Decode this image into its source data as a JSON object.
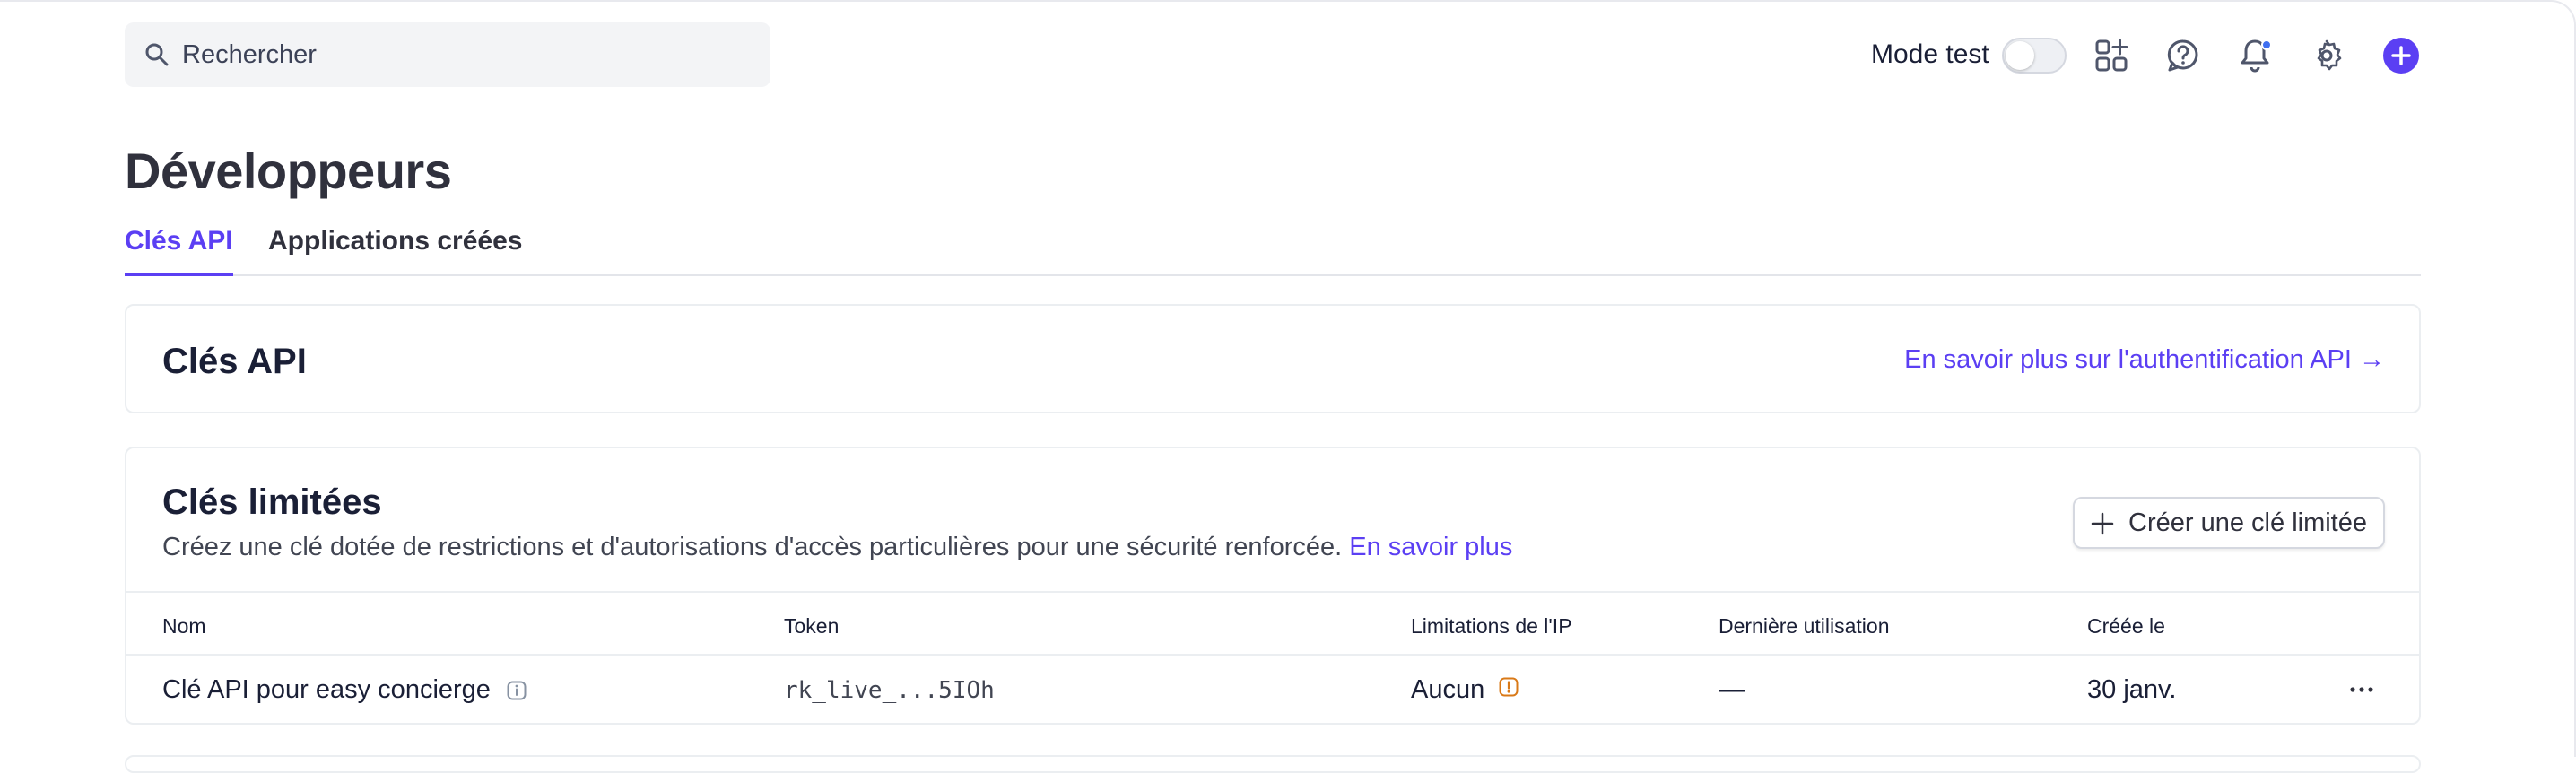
{
  "search": {
    "placeholder": "Rechercher"
  },
  "topbar": {
    "mode_label": "Mode test",
    "icons": [
      "search-icon",
      "apps-add-icon",
      "help-icon",
      "bell-icon",
      "gear-icon",
      "plus-icon"
    ],
    "accent": "#5b3ff3"
  },
  "page": {
    "title": "Développeurs"
  },
  "tabs": [
    {
      "label": "Clés API",
      "active": true
    },
    {
      "label": "Applications créées",
      "active": false
    }
  ],
  "api_keys_card": {
    "title": "Clés API",
    "link": "En savoir plus sur l'authentification API →"
  },
  "restricted_card": {
    "title": "Clés limitées",
    "description": "Créez une clé dotée de restrictions et d'autorisations d'accès particulières pour une sécurité renforcée.",
    "more_link": "En savoir plus",
    "create_button": "Créer une clé limitée",
    "columns": [
      "Nom",
      "Token",
      "Limitations de l'IP",
      "Dernière utilisation",
      "Créée le"
    ],
    "rows": [
      {
        "name": "Clé API pour easy concierge",
        "token": "rk_live_...5IOh",
        "ip_limits": "Aucun",
        "last_used": "—",
        "created": "30 janv."
      }
    ]
  }
}
